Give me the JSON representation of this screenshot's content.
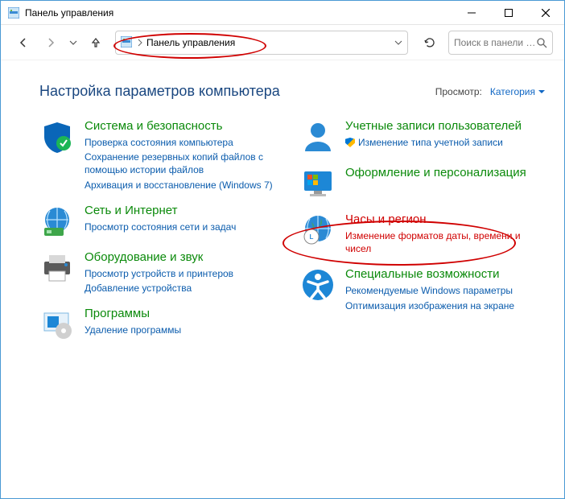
{
  "window": {
    "title": "Панель управления"
  },
  "nav": {
    "breadcrumb": "Панель управления",
    "search_placeholder": "Поиск в панели у..."
  },
  "header": {
    "title": "Настройка параметров компьютера",
    "view_label": "Просмотр:",
    "view_value": "Категория"
  },
  "left": {
    "security": {
      "title": "Система и безопасность",
      "link1": "Проверка состояния компьютера",
      "link2": "Сохранение резервных копий файлов с помощью истории файлов",
      "link3": "Архивация и восстановление (Windows 7)"
    },
    "network": {
      "title": "Сеть и Интернет",
      "link1": "Просмотр состояния сети и задач"
    },
    "hardware": {
      "title": "Оборудование и звук",
      "link1": "Просмотр устройств и принтеров",
      "link2": "Добавление устройства"
    },
    "programs": {
      "title": "Программы",
      "link1": "Удаление программы"
    }
  },
  "right": {
    "users": {
      "title": "Учетные записи пользователей",
      "link1": "Изменение типа учетной записи"
    },
    "appearance": {
      "title": "Оформление и персонализация"
    },
    "clock": {
      "title": "Часы и регион",
      "link1": "Изменение форматов даты, времени и чисел"
    },
    "ease": {
      "title": "Специальные возможности",
      "link1": "Рекомендуемые Windows параметры",
      "link2": "Оптимизация изображения на экране"
    }
  }
}
